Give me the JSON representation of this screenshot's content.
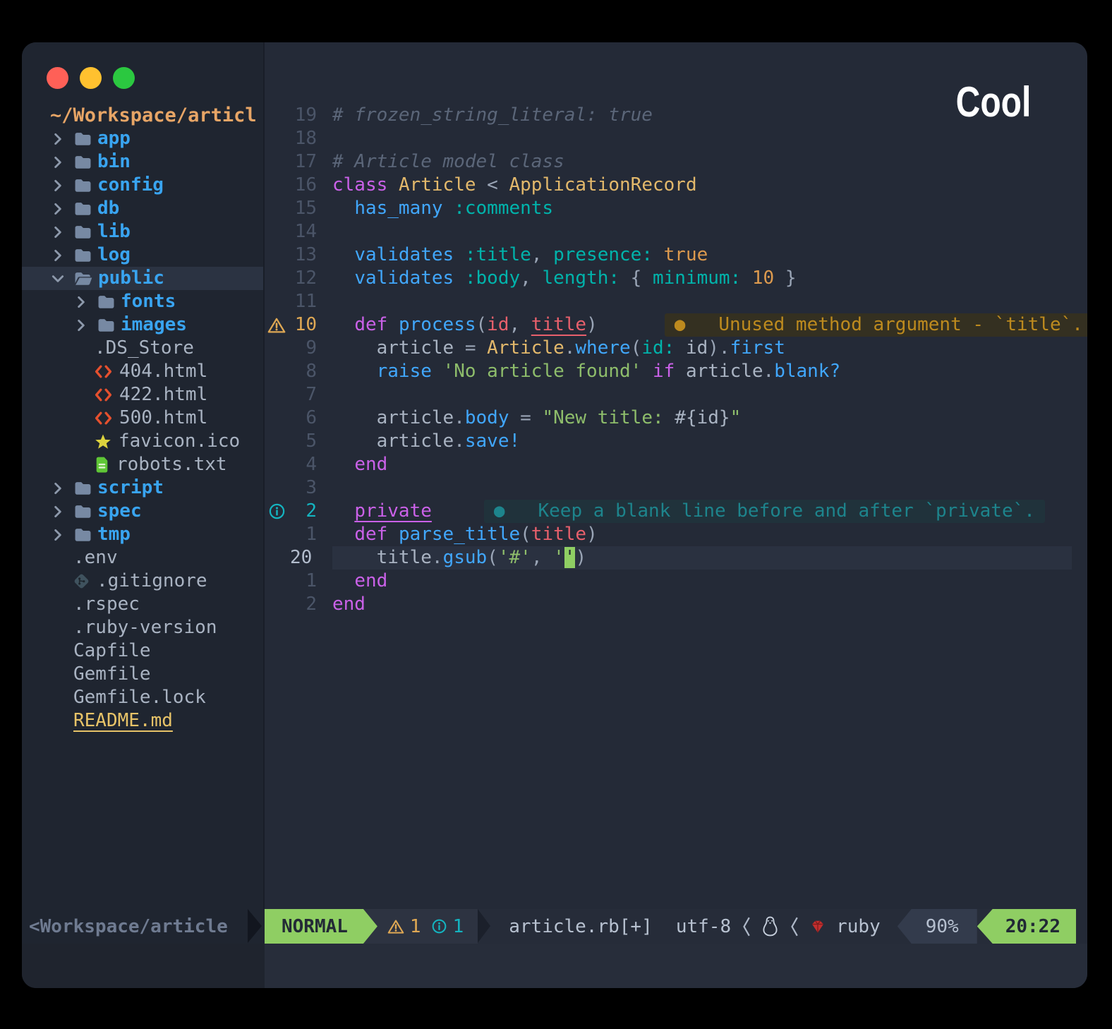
{
  "window": {
    "overlay_label": "Cool"
  },
  "colors": {
    "page_bg": "#000000",
    "editor_bg": "#242a37",
    "sidebar_bg": "#1f2530",
    "selection_bg": "#2b3342",
    "cursorline_bg": "#2a3140",
    "accent_green": "#8fce63",
    "folder_blue": "#39a4f0",
    "icon_gray": "#7789a3",
    "text_gray": "#a9b3c2",
    "root_orange": "#e7a566",
    "readme_yellow": "#e7c368",
    "keyword_magenta": "#ca61e8",
    "type_yellow": "#e2b86b",
    "func_blue": "#41a7fc",
    "symbol_teal": "#00b3ab",
    "string_green": "#8ebd6b",
    "number_orange": "#dd9a4e",
    "param_red": "#e8606c",
    "comment_gray": "#5b6679",
    "warn_amber": "#dfa854",
    "info_teal": "#14b4c0",
    "vt_warn_fg": "#bd8a1e",
    "vt_warn_bg": "#343021",
    "vt_hint_fg": "#1d848c",
    "vt_hint_bg": "#20323b",
    "traffic_red": "#ff6057",
    "traffic_yellow": "#ffc12f",
    "traffic_green": "#2bc840",
    "ruby_red": "#c22f2f"
  },
  "icons": [
    "chevron-right-icon",
    "chevron-down-icon",
    "folder-icon",
    "folder-open-icon",
    "html-code-icon",
    "star-icon",
    "text-file-icon",
    "git-icon",
    "warning-triangle-icon",
    "info-circle-icon",
    "tux-penguin-icon",
    "ruby-gem-icon",
    "angle-separator-icon"
  ],
  "sidebar": {
    "root": "~/Workspace/articl",
    "items": [
      {
        "label": "app",
        "type": "folder",
        "indent": 0
      },
      {
        "label": "bin",
        "type": "folder",
        "indent": 0
      },
      {
        "label": "config",
        "type": "folder",
        "indent": 0
      },
      {
        "label": "db",
        "type": "folder",
        "indent": 0
      },
      {
        "label": "lib",
        "type": "folder",
        "indent": 0
      },
      {
        "label": "log",
        "type": "folder",
        "indent": 0
      },
      {
        "label": "public",
        "type": "folder-open",
        "indent": 0,
        "selected": true
      },
      {
        "label": "fonts",
        "type": "folder",
        "indent": 1
      },
      {
        "label": "images",
        "type": "folder",
        "indent": 1
      },
      {
        "label": ".DS_Store",
        "type": "file",
        "icon": "none",
        "indent": 1
      },
      {
        "label": "404.html",
        "type": "file",
        "icon": "html",
        "indent": 1
      },
      {
        "label": "422.html",
        "type": "file",
        "icon": "html",
        "indent": 1
      },
      {
        "label": "500.html",
        "type": "file",
        "icon": "html",
        "indent": 1
      },
      {
        "label": "favicon.ico",
        "type": "file",
        "icon": "star",
        "indent": 1
      },
      {
        "label": "robots.txt",
        "type": "file",
        "icon": "doc",
        "indent": 1
      },
      {
        "label": "script",
        "type": "folder",
        "indent": 0
      },
      {
        "label": "spec",
        "type": "folder",
        "indent": 0
      },
      {
        "label": "tmp",
        "type": "folder",
        "indent": 0
      },
      {
        "label": ".env",
        "type": "file",
        "icon": "none",
        "indent": 0
      },
      {
        "label": ".gitignore",
        "type": "file",
        "icon": "git",
        "indent": 0
      },
      {
        "label": ".rspec",
        "type": "file",
        "icon": "none",
        "indent": 0
      },
      {
        "label": ".ruby-version",
        "type": "file",
        "icon": "none",
        "indent": 0
      },
      {
        "label": "Capfile",
        "type": "file",
        "icon": "none",
        "indent": 0
      },
      {
        "label": "Gemfile",
        "type": "file",
        "icon": "none",
        "indent": 0
      },
      {
        "label": "Gemfile.lock",
        "type": "file",
        "icon": "none",
        "indent": 0
      },
      {
        "label": "README.md",
        "type": "file",
        "icon": "none",
        "indent": 0,
        "style": "readme"
      }
    ]
  },
  "editor": {
    "lines": [
      {
        "n": "19",
        "tokens": [
          [
            "c",
            "# frozen_string_literal: true"
          ]
        ]
      },
      {
        "n": "18",
        "tokens": []
      },
      {
        "n": "17",
        "tokens": [
          [
            "c",
            "# Article model class"
          ]
        ]
      },
      {
        "n": "16",
        "tokens": [
          [
            "k",
            "class"
          ],
          [
            "o",
            " "
          ],
          [
            "t",
            "Article"
          ],
          [
            "o",
            " < "
          ],
          [
            "t",
            "ApplicationRecord"
          ]
        ]
      },
      {
        "n": "15",
        "tokens": [
          [
            "o",
            "  "
          ],
          [
            "f",
            "has_many"
          ],
          [
            "o",
            " "
          ],
          [
            "s",
            ":comments"
          ]
        ]
      },
      {
        "n": "14",
        "tokens": []
      },
      {
        "n": "13",
        "tokens": [
          [
            "o",
            "  "
          ],
          [
            "f",
            "validates"
          ],
          [
            "o",
            " "
          ],
          [
            "s",
            ":title"
          ],
          [
            "o",
            ", "
          ],
          [
            "s",
            "presence:"
          ],
          [
            "o",
            " "
          ],
          [
            "n",
            "true"
          ]
        ]
      },
      {
        "n": "12",
        "tokens": [
          [
            "o",
            "  "
          ],
          [
            "f",
            "validates"
          ],
          [
            "o",
            " "
          ],
          [
            "s",
            ":body"
          ],
          [
            "o",
            ", "
          ],
          [
            "s",
            "length:"
          ],
          [
            "o",
            " { "
          ],
          [
            "s",
            "minimum:"
          ],
          [
            "o",
            " "
          ],
          [
            "n",
            "10"
          ],
          [
            "o",
            " }"
          ]
        ]
      },
      {
        "n": "11",
        "tokens": []
      },
      {
        "n": "10",
        "ncls": "warn",
        "sign": "warn",
        "tokens": [
          [
            "o",
            "  "
          ],
          [
            "k",
            "def"
          ],
          [
            "o",
            " "
          ],
          [
            "f",
            "process"
          ],
          [
            "o",
            "("
          ],
          [
            "p",
            "id"
          ],
          [
            "o",
            ", "
          ],
          [
            "pu",
            "title"
          ],
          [
            "o",
            ")"
          ]
        ],
        "vtext": {
          "kind": "warn",
          "gap": 95,
          "text": "●   Unused method argument - `title`."
        }
      },
      {
        "n": "9",
        "tokens": [
          [
            "o",
            "    "
          ],
          [
            "v",
            "article"
          ],
          [
            "o",
            " = "
          ],
          [
            "t",
            "Article"
          ],
          [
            "o",
            "."
          ],
          [
            "f",
            "where"
          ],
          [
            "o",
            "("
          ],
          [
            "s",
            "id:"
          ],
          [
            "o",
            " "
          ],
          [
            "v",
            "id"
          ],
          [
            "o",
            ")."
          ],
          [
            "f",
            "first"
          ]
        ]
      },
      {
        "n": "8",
        "tokens": [
          [
            "o",
            "    "
          ],
          [
            "f",
            "raise"
          ],
          [
            "o",
            " "
          ],
          [
            "str",
            "'No article found'"
          ],
          [
            "o",
            " "
          ],
          [
            "k",
            "if"
          ],
          [
            "o",
            " "
          ],
          [
            "v",
            "article"
          ],
          [
            "o",
            "."
          ],
          [
            "f",
            "blank?"
          ]
        ]
      },
      {
        "n": "7",
        "tokens": []
      },
      {
        "n": "6",
        "tokens": [
          [
            "o",
            "    "
          ],
          [
            "v",
            "article"
          ],
          [
            "o",
            "."
          ],
          [
            "f",
            "body"
          ],
          [
            "o",
            " = "
          ],
          [
            "str",
            "\"New title: "
          ],
          [
            "v",
            "#{id}"
          ],
          [
            "str",
            "\""
          ]
        ]
      },
      {
        "n": "5",
        "tokens": [
          [
            "o",
            "    "
          ],
          [
            "v",
            "article"
          ],
          [
            "o",
            "."
          ],
          [
            "f",
            "save!"
          ]
        ]
      },
      {
        "n": "4",
        "tokens": [
          [
            "o",
            "  "
          ],
          [
            "k",
            "end"
          ]
        ]
      },
      {
        "n": "3",
        "tokens": []
      },
      {
        "n": "2",
        "ncls": "info",
        "sign": "info",
        "tokens": [
          [
            "o",
            "  "
          ],
          [
            "ku",
            "private"
          ]
        ],
        "vtext": {
          "kind": "hint",
          "gap": 74,
          "text": "●   Keep a blank line before and after `private`."
        }
      },
      {
        "n": "1",
        "tokens": [
          [
            "o",
            "  "
          ],
          [
            "k",
            "def"
          ],
          [
            "o",
            " "
          ],
          [
            "f",
            "parse_title"
          ],
          [
            "o",
            "("
          ],
          [
            "p",
            "title"
          ],
          [
            "o",
            ")"
          ]
        ]
      },
      {
        "n": "20",
        "ncls": "cur",
        "cur": true,
        "tokens": [
          [
            "o",
            "    "
          ],
          [
            "v",
            "title"
          ],
          [
            "o",
            "."
          ],
          [
            "f",
            "gsub"
          ],
          [
            "o",
            "("
          ],
          [
            "str",
            "'#'"
          ],
          [
            "o",
            ", "
          ],
          [
            "str",
            "'"
          ],
          [
            "cur",
            "'"
          ],
          [
            "o",
            ")"
          ]
        ]
      },
      {
        "n": "1",
        "tokens": [
          [
            "o",
            "  "
          ],
          [
            "k",
            "end"
          ]
        ]
      },
      {
        "n": "2",
        "tokens": [
          [
            "k",
            "end"
          ]
        ]
      }
    ]
  },
  "statusline": {
    "workdir": "<Workspace/article",
    "mode": "NORMAL",
    "diag": {
      "warn_count": "1",
      "info_count": "1"
    },
    "file": "article.rb[+]",
    "encoding": "utf-8",
    "lang": "ruby",
    "percent": "90%",
    "time": "20:22"
  }
}
